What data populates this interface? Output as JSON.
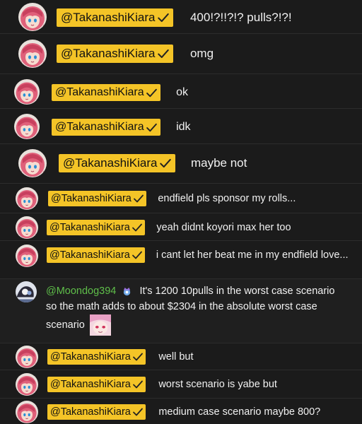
{
  "colors": {
    "background": "#1b1b1b",
    "member_badge": "#f4c427",
    "member_name": "#5fbf4a",
    "text": "#f1f1f1"
  },
  "messages": [
    {
      "author": "@TakanashiKiara",
      "verified_icon": "checkmark-icon",
      "text": "400!?!!?!? pulls?!?!"
    },
    {
      "author": "@TakanashiKiara",
      "verified_icon": "checkmark-icon",
      "text": "omg"
    },
    {
      "author": "@TakanashiKiara",
      "verified_icon": "checkmark-icon",
      "text": "ok"
    },
    {
      "author": "@TakanashiKiara",
      "verified_icon": "checkmark-icon",
      "text": "idk"
    },
    {
      "author": "@TakanashiKiara",
      "verified_icon": "checkmark-icon",
      "text": "maybe not"
    },
    {
      "author": "@TakanashiKiara",
      "verified_icon": "checkmark-icon",
      "text": "endfield pls sponsor my rolls..."
    },
    {
      "author": "@TakanashiKiara",
      "verified_icon": "checkmark-icon",
      "text": "yeah didnt koyori max her too"
    },
    {
      "author": "@TakanashiKiara",
      "verified_icon": "checkmark-icon",
      "text": "i cant let her beat me in my endfield love..."
    },
    {
      "author": "@Moondog394",
      "badge_icon": "member-badge-icon",
      "text": "It's 1200 10pulls in the worst case scenario so the math adds to about $2304 in the absolute worst case scenario",
      "emote_icon": "anime-face-emote-icon"
    },
    {
      "author": "@TakanashiKiara",
      "verified_icon": "checkmark-icon",
      "text": "well but"
    },
    {
      "author": "@TakanashiKiara",
      "verified_icon": "checkmark-icon",
      "text": "worst scenario is yabe but"
    },
    {
      "author": "@TakanashiKiara",
      "verified_icon": "checkmark-icon",
      "text": "medium case scenario maybe 800?"
    }
  ]
}
